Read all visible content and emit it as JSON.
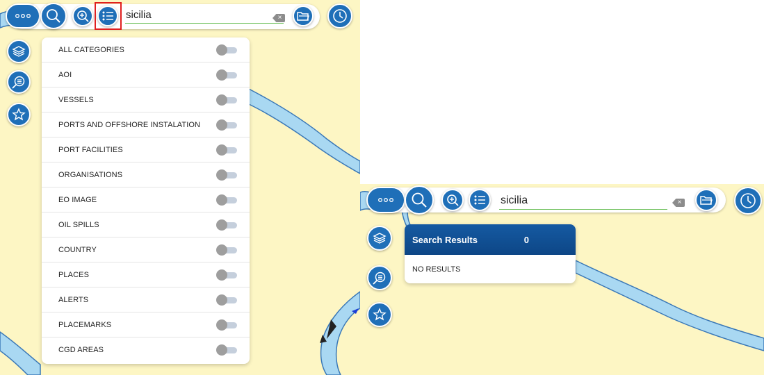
{
  "colors": {
    "map_land": "#fdf6c4",
    "map_water": "#a9d8f2",
    "map_water_stroke": "#3a78b7",
    "button_blue": "#1f6fb8",
    "results_header": "#0d4686",
    "highlight_red": "#e02020",
    "toggle_off": "#9e9e9e"
  },
  "left_view": {
    "toolbar": {
      "menu_icon": "more-dots-icon",
      "search_button_icon": "search-icon",
      "zoom_button_icon": "zoom-in-icon",
      "categories_button_icon": "list-icon",
      "search_value": "sicilia",
      "clear_icon": "backspace-clear-icon",
      "open_folder_icon": "folder-open-icon",
      "history_icon": "clock-icon"
    },
    "side_buttons": [
      "layers-icon",
      "search-zoom-icon",
      "star-icon"
    ],
    "categories": [
      {
        "label": "ALL CATEGORIES",
        "enabled": false
      },
      {
        "label": "AOI",
        "enabled": false
      },
      {
        "label": "VESSELS",
        "enabled": false
      },
      {
        "label": "PORTS AND OFFSHORE INSTALATION",
        "enabled": false
      },
      {
        "label": "PORT FACILITIES",
        "enabled": false
      },
      {
        "label": "ORGANISATIONS",
        "enabled": false
      },
      {
        "label": "EO IMAGE",
        "enabled": false
      },
      {
        "label": "OIL SPILLS",
        "enabled": false
      },
      {
        "label": "COUNTRY",
        "enabled": false
      },
      {
        "label": "PLACES",
        "enabled": false
      },
      {
        "label": "ALERTS",
        "enabled": false
      },
      {
        "label": "PLACEMARKS",
        "enabled": false
      },
      {
        "label": "CGD AREAS",
        "enabled": false
      }
    ]
  },
  "right_view": {
    "toolbar": {
      "search_value": "sicilia"
    },
    "results": {
      "title": "Search Results",
      "count": "0",
      "empty_message": "NO RESULTS"
    }
  }
}
